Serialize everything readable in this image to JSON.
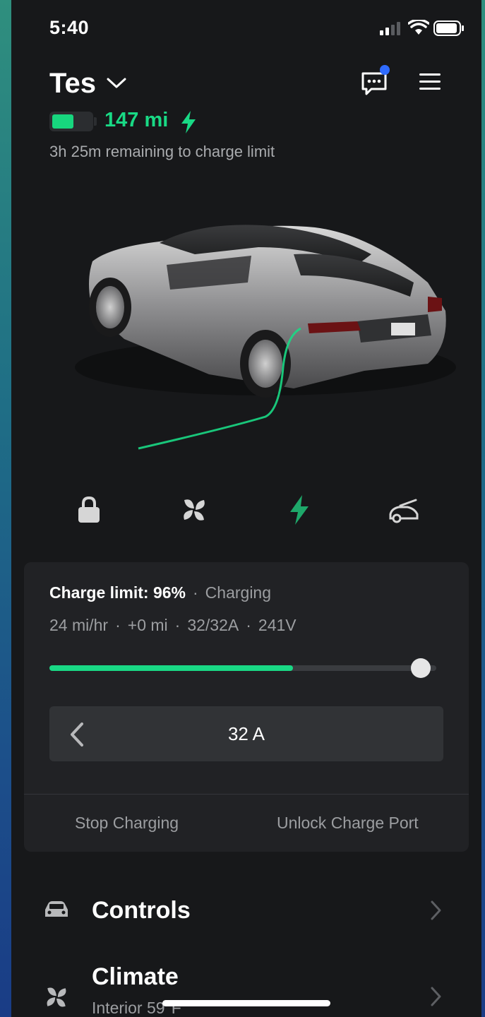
{
  "status_bar": {
    "time": "5:40"
  },
  "header": {
    "vehicle_name": "Tes",
    "has_notification": true
  },
  "battery": {
    "range": "147 mi",
    "level_fraction": 0.55,
    "remaining_text": "3h 25m remaining to charge limit"
  },
  "quick_controls": [
    {
      "name": "lock",
      "icon": "lock-icon"
    },
    {
      "name": "climate",
      "icon": "fan-icon"
    },
    {
      "name": "charging",
      "icon": "bolt-icon",
      "active": true
    },
    {
      "name": "trunk",
      "icon": "car-trunk-icon"
    }
  ],
  "charging": {
    "limit_label": "Charge limit: 96%",
    "state": "Charging",
    "rate": "24 mi/hr",
    "added": "+0 mi",
    "current": "32/32A",
    "voltage": "241V",
    "separator": "·",
    "charge_level_fraction": 0.63,
    "limit_fraction": 0.96,
    "amps": "32 A",
    "stop_label": "Stop Charging",
    "unlock_label": "Unlock Charge Port"
  },
  "menu": {
    "controls_label": "Controls",
    "climate_label": "Climate",
    "climate_sub": "Interior 59°F"
  },
  "colors": {
    "accent_green": "#19d985",
    "background": "#17181a",
    "card": "#212225",
    "notification": "#2f6bff"
  }
}
